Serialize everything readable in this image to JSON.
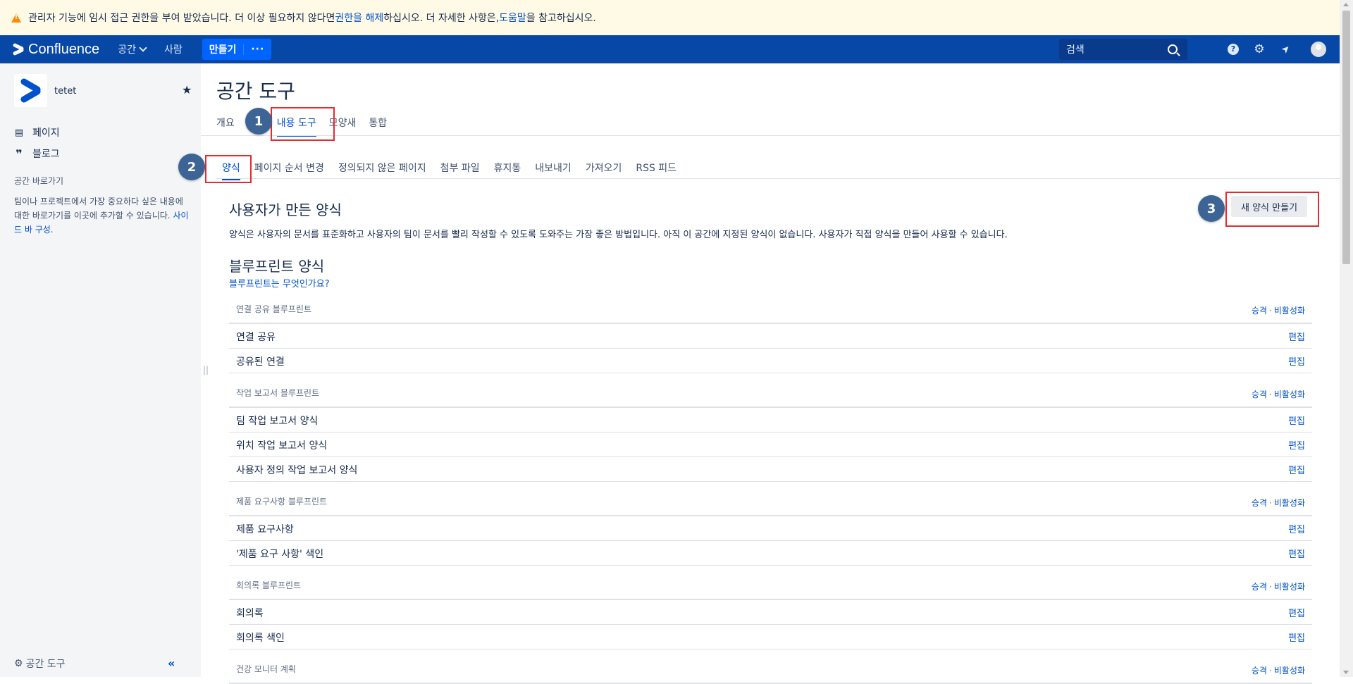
{
  "banner": {
    "text_before": "관리자 기능에 임시 접근 권한을 부여 받았습니다. 더 이상 필요하지 않다면 ",
    "link1": "권한을 해제",
    "text_middle": "하십시오. 더 자세한 사항은, ",
    "link2": "도움말",
    "text_after": "을 참고하십시오."
  },
  "topnav": {
    "logo": "Confluence",
    "spaces": "공간",
    "people": "사람",
    "create": "만들기",
    "more": "···",
    "search_placeholder": "검색",
    "help": "?",
    "settings": "⚙",
    "notifications": "➤"
  },
  "sidebar": {
    "space_name": "tetet",
    "pages": "페이지",
    "blog": "블로그",
    "shortcuts_title": "공간 바로가기",
    "shortcuts_text": "팀이나 프로젝트에서 가장 중요하다 싶은 내용에 대한 바로가기를 이곳에 추가할 수 있습니다.",
    "shortcuts_link": "사이드 바 구성",
    "shortcuts_end": ".",
    "space_tools": "공간 도구",
    "collapse": "«"
  },
  "main": {
    "title": "공간 도구",
    "tabs": [
      "개요",
      "내용 도구",
      "모양새",
      "통합"
    ],
    "subtabs": [
      "양식",
      "페이지 순서 변경",
      "정의되지 않은 페이지",
      "첨부 파일",
      "휴지통",
      "내보내기",
      "가져오기",
      "RSS 피드"
    ],
    "user_templates_title": "사용자가 만든 양식",
    "user_templates_desc": "양식은 사용자의 문서를 표준화하고 사용자의 팀이 문서를 빨리 작성할 수 있도록 도와주는 가장 좋은 방법입니다. 아직 이 공간에 지정된 양식이 없습니다. 사용자가 직접 양식을 만들어 사용할 수 있습니다.",
    "new_template_button": "새 양식 만들기",
    "blueprints_title": "블루프린트 양식",
    "blueprints_link": "블루프린트는 무엇인가요?",
    "promote": "승격",
    "separator": "·",
    "disable": "비활성화",
    "edit": "편집",
    "groups": [
      {
        "name": "연결 공유 블루프린트",
        "items": [
          "연결 공유",
          "공유된 연결"
        ]
      },
      {
        "name": "작업 보고서 블루프린트",
        "items": [
          "팀 작업 보고서 양식",
          "위치 작업 보고서 양식",
          "사용자 정의 작업 보고서 양식"
        ]
      },
      {
        "name": "제품 요구사항 블루프린트",
        "items": [
          "제품 요구사항",
          "'제품 요구 사항' 색인"
        ]
      },
      {
        "name": "회의록 블루프린트",
        "items": [
          "회의록",
          "회의록 색인"
        ]
      },
      {
        "name": "건강 모니터 계획",
        "items": []
      }
    ]
  },
  "annotations": [
    "1",
    "2",
    "3"
  ],
  "colors": {
    "nav": "#0747a6",
    "accent": "#0052cc",
    "highlight": "#e52b2b",
    "callout": "#3c6494",
    "banner": "#fffae6"
  }
}
